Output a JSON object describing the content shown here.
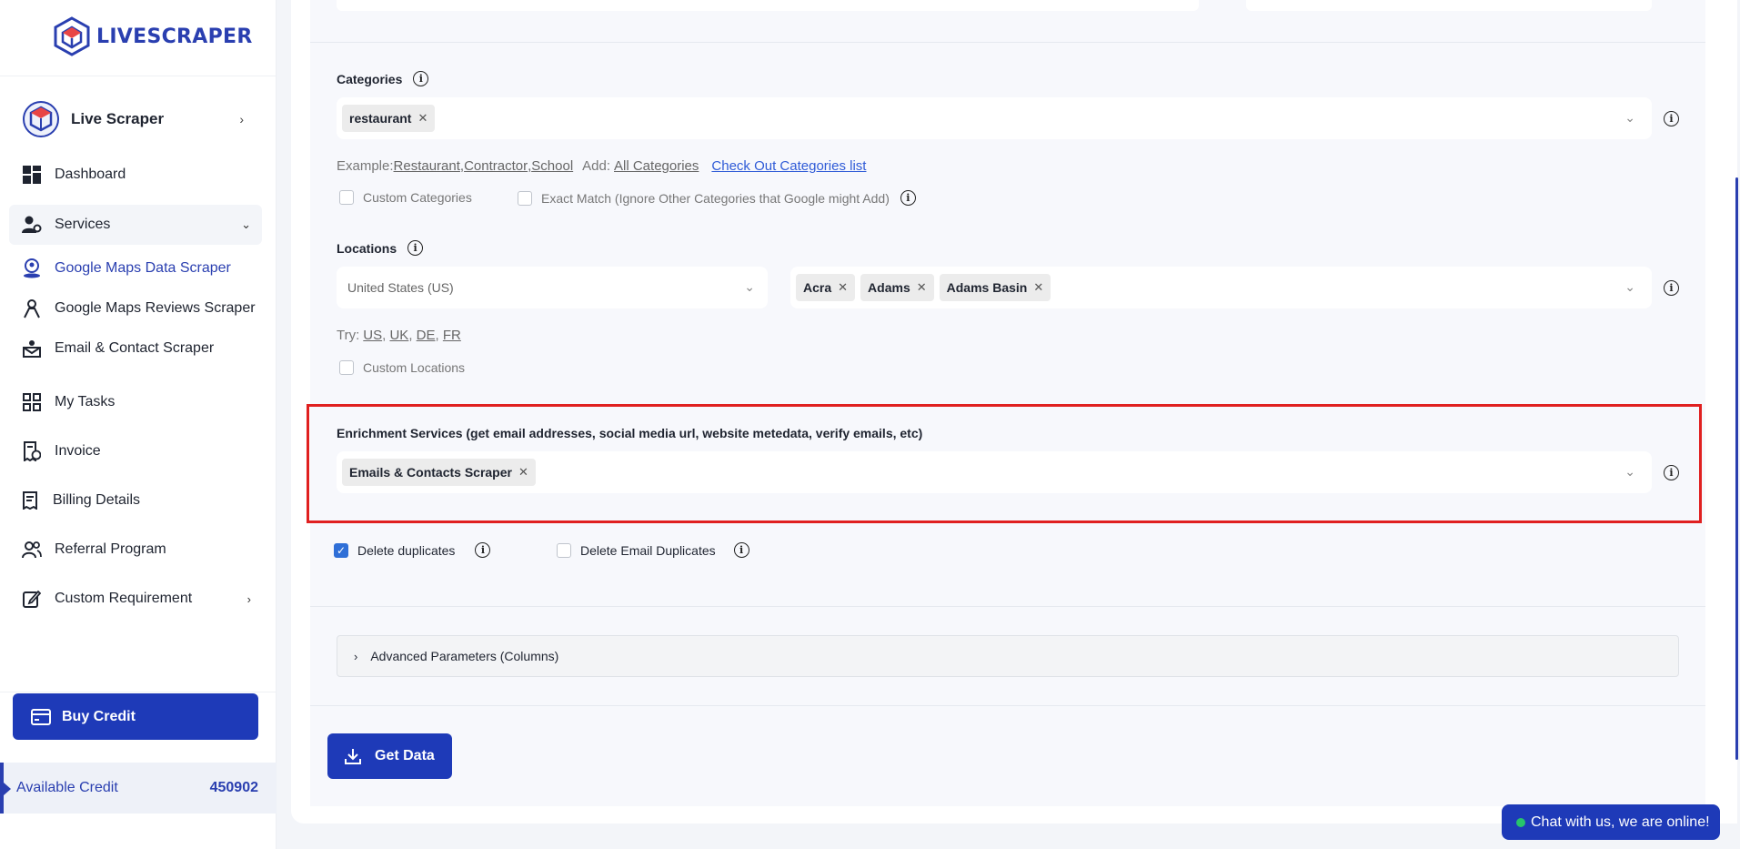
{
  "sidebar": {
    "logo_text_a": "LIVE",
    "logo_text_b": "SCRAPER",
    "brand": "Live Scraper",
    "items": {
      "dashboard": "Dashboard",
      "services": "Services",
      "gmaps_data": "Google Maps Data Scraper",
      "gmaps_reviews": "Google Maps Reviews Scraper",
      "email_contact": "Email & Contact Scraper",
      "tasks": "My Tasks",
      "invoice": "Invoice",
      "billing": "Billing Details",
      "referral": "Referral Program",
      "custom": "Custom Requirement"
    },
    "buy_credit": "Buy Credit",
    "available_credit_label": "Available Credit",
    "available_credit_value": "450902"
  },
  "categories": {
    "label": "Categories",
    "tags": [
      "restaurant"
    ],
    "example_prefix": "Example:",
    "examples": [
      "Restaurant",
      ",",
      "Contractor",
      ",",
      "School"
    ],
    "add_prefix": "Add:",
    "add_all": "All Categories",
    "list_link": "Check Out Categories list",
    "custom_label": "Custom Categories",
    "exact_match_label": "Exact Match (Ignore Other Categories that Google might Add)"
  },
  "locations": {
    "label": "Locations",
    "country": "United States (US)",
    "tags": [
      "Acra",
      "Adams",
      "Adams Basin"
    ],
    "try_prefix": "Try:",
    "try_us": "US",
    "try_uk": "UK",
    "try_de": "DE",
    "try_fr": "FR",
    "custom_label": "Custom Locations"
  },
  "enrichment": {
    "label": "Enrichment Services (get email addresses, social media url, website metedata, verify emails, etc)",
    "tags": [
      "Emails & Contacts Scraper"
    ]
  },
  "options": {
    "delete_duplicates": "Delete duplicates",
    "delete_email_duplicates": "Delete Email Duplicates",
    "delete_duplicates_checked": true,
    "delete_email_duplicates_checked": false
  },
  "advanced": {
    "label": "Advanced Parameters (Columns)"
  },
  "actions": {
    "get_data": "Get Data"
  },
  "chat": {
    "label": "Chat with us, we are online!"
  },
  "colors": {
    "primary": "#1e3ab8",
    "highlight": "#e02020",
    "online": "#27c46b"
  }
}
